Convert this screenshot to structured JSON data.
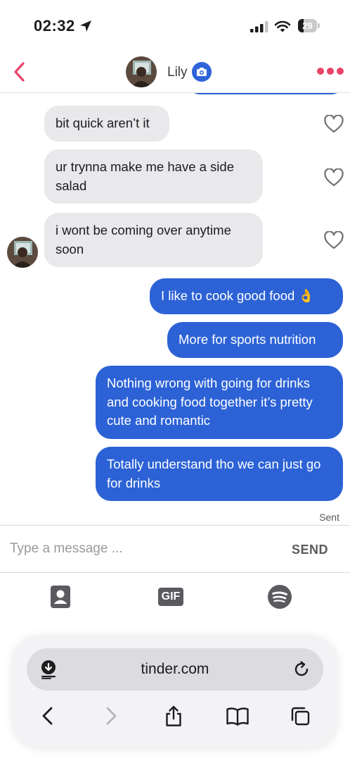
{
  "status_bar": {
    "time": "02:32",
    "battery_level": "29",
    "battery_fraction": 0.29,
    "icons": [
      "location-arrow-icon",
      "cellular-signal-icon",
      "wifi-icon",
      "battery-icon"
    ]
  },
  "header": {
    "contact_name": "Lily",
    "icons": [
      "back-chevron-icon",
      "verified-camera-icon",
      "more-dots-icon"
    ],
    "accent_color": "#e94368",
    "badge_color": "#2f64d8"
  },
  "messages": [
    {
      "direction": "incoming",
      "text": "bit quick aren’t it"
    },
    {
      "direction": "incoming",
      "text": "ur trynna make me have a side salad"
    },
    {
      "direction": "incoming",
      "text": "i wont be coming over anytime soon"
    },
    {
      "direction": "outgoing",
      "text": "I like to cook good food 👌"
    },
    {
      "direction": "outgoing",
      "text": "More for sports nutrition"
    },
    {
      "direction": "outgoing",
      "text": "Nothing wrong with going for drinks and cooking food together it’s pretty cute and romantic"
    },
    {
      "direction": "outgoing",
      "text": "Totally understand tho we can just go for drinks"
    }
  ],
  "delivery_status": "Sent",
  "composer": {
    "placeholder": "Type a message ...",
    "value": "",
    "send_label": "SEND"
  },
  "attachments": {
    "contact_icon": "contact-card-icon",
    "gif_label": "GIF",
    "spotify_icon": "spotify-icon"
  },
  "browser": {
    "url": "tinder.com",
    "toolbar_icons": [
      "back-icon",
      "forward-icon",
      "share-icon",
      "bookmarks-icon",
      "tabs-icon"
    ]
  },
  "colors": {
    "outgoing_bubble": "#2c62d6",
    "incoming_bubble": "#e9e9eb",
    "heart_outline": "#6f6f6f"
  }
}
